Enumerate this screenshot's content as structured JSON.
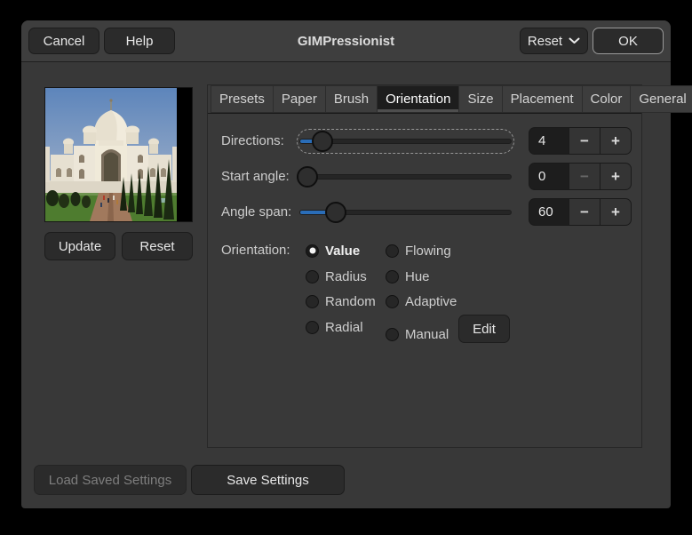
{
  "window": {
    "title": "GIMPressionist"
  },
  "header": {
    "cancel_label": "Cancel",
    "help_label": "Help",
    "reset_label": "Reset",
    "ok_label": "OK"
  },
  "preview": {
    "image_name": "taj-mahal-preview",
    "update_label": "Update",
    "reset_label": "Reset"
  },
  "tabs": [
    {
      "label": "Presets",
      "active": false
    },
    {
      "label": "Paper",
      "active": false
    },
    {
      "label": "Brush",
      "active": false
    },
    {
      "label": "Orientation",
      "active": true
    },
    {
      "label": "Size",
      "active": false
    },
    {
      "label": "Placement",
      "active": false
    },
    {
      "label": "Color",
      "active": false
    },
    {
      "label": "General",
      "active": false
    }
  ],
  "sliders": [
    {
      "label": "Directions:",
      "value": "4",
      "fraction": 0.11,
      "focused": true,
      "minus_disabled": false
    },
    {
      "label": "Start angle:",
      "value": "0",
      "fraction": 0.0,
      "focused": false,
      "minus_disabled": true
    },
    {
      "label": "Angle span:",
      "value": "60",
      "fraction": 0.17,
      "focused": false,
      "minus_disabled": false
    }
  ],
  "orientation": {
    "label": "Orientation:",
    "radios": [
      {
        "label": "Value",
        "selected": true
      },
      {
        "label": "Radius",
        "selected": false
      },
      {
        "label": "Random",
        "selected": false
      },
      {
        "label": "Radial",
        "selected": false
      },
      {
        "label": "Flowing",
        "selected": false
      },
      {
        "label": "Hue",
        "selected": false
      },
      {
        "label": "Adaptive",
        "selected": false
      },
      {
        "label": "Manual",
        "selected": false
      }
    ],
    "edit_label": "Edit"
  },
  "footer": {
    "load_label": "Load Saved Settings",
    "load_disabled": true,
    "save_label": "Save Settings"
  },
  "icons": {
    "minus": "−",
    "plus": "+"
  },
  "colors": {
    "accent_blue": "#2a6db8",
    "dialog_bg": "#383838",
    "header_bg": "#3e3e3e",
    "entry_bg": "#1d1d1d",
    "active_tab_bg": "#1d1d1d"
  }
}
